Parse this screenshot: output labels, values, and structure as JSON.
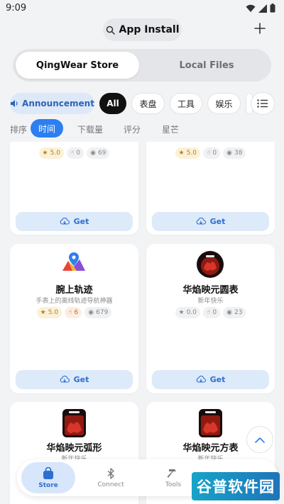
{
  "status_bar": {
    "time": "9:09"
  },
  "header": {
    "title": "App Install"
  },
  "tabs": [
    "QingWear Store",
    "Local Files"
  ],
  "categories": {
    "announcement": "Announcement",
    "items": [
      "All",
      "表盘",
      "工具",
      "娱乐",
      ""
    ]
  },
  "sort": {
    "label": "排序",
    "options": [
      "时间",
      "下载量",
      "评分",
      "星芒"
    ]
  },
  "cards": [
    {
      "rating": "5.0",
      "likes": "0",
      "views": "69",
      "get": "Get"
    },
    {
      "rating": "5.0",
      "likes": "0",
      "views": "38",
      "get": "Get"
    },
    {
      "title": "腕上轨迹",
      "subtitle": "手表上的离线轨迹导航神器",
      "rating": "5.0",
      "likes": "6",
      "views": "679",
      "get": "Get"
    },
    {
      "title": "华焰映元圆表",
      "subtitle": "新年快乐",
      "rating": "0.0",
      "likes": "0",
      "views": "23",
      "get": "Get"
    },
    {
      "title": "华焰映元弧形",
      "subtitle": "新年快乐"
    },
    {
      "title": "华焰映元方表",
      "subtitle": "新年快乐"
    }
  ],
  "nav": [
    "Store",
    "Connect",
    "Tools",
    ""
  ],
  "watermark": "谷普软件园",
  "colors": {
    "accent": "#2d7ff0",
    "get_bg": "#ddeaf9",
    "rating": "#b88315"
  }
}
